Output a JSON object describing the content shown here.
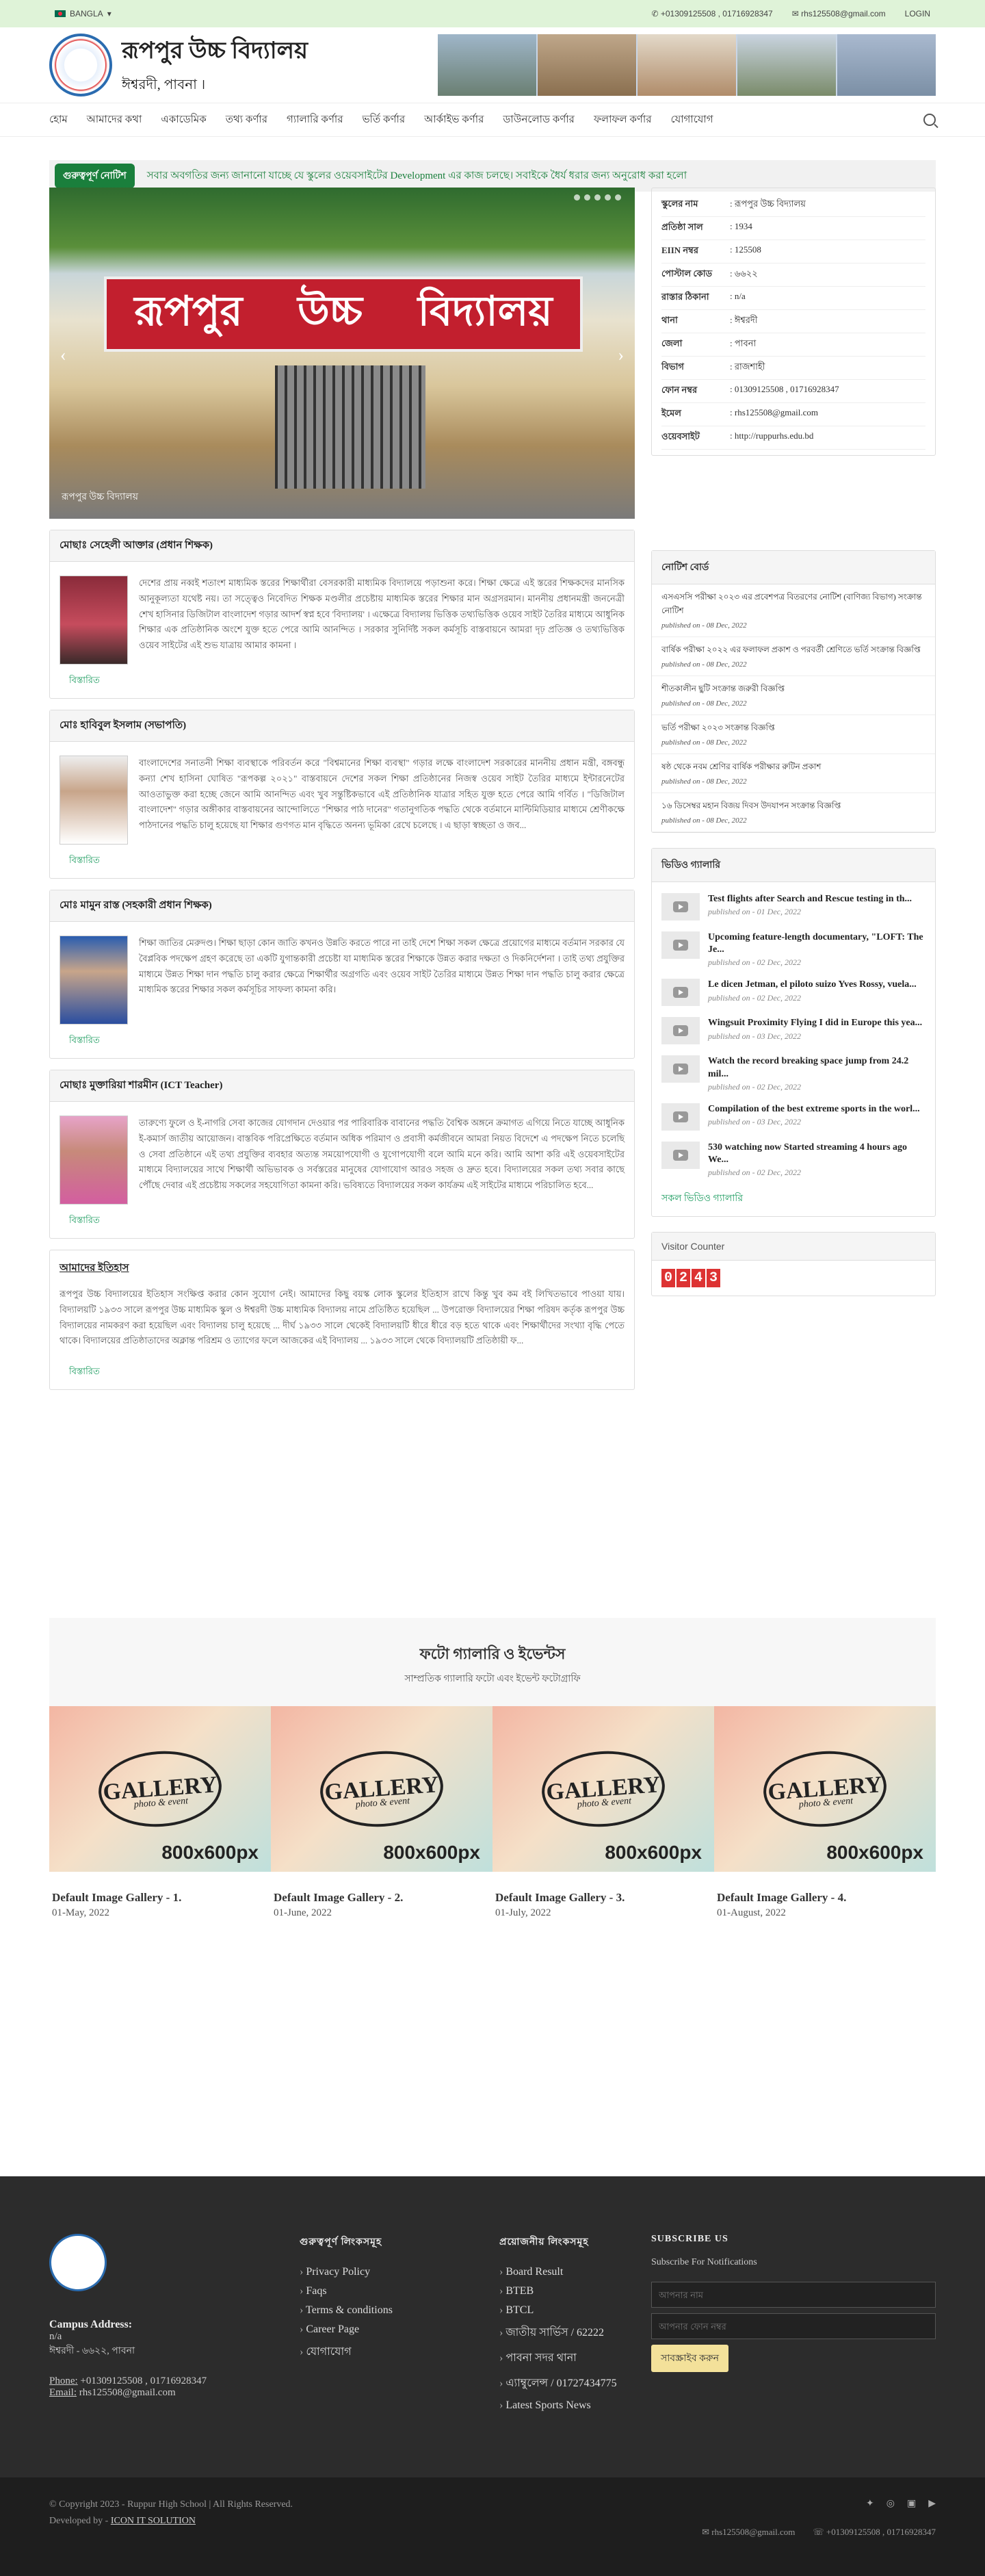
{
  "topbar": {
    "lang": "BANGLA",
    "phone": "+01309125508 , 01716928347",
    "email": "rhs125508@gmail.com",
    "login": "LOGIN"
  },
  "header": {
    "name": "রূপপুর উচ্চ বিদ্যালয়",
    "address": "ঈশ্বরদী, পাবনা ।"
  },
  "nav": [
    "হোম",
    "আমাদের কথা",
    "একাডেমিক",
    "তথ্য কর্ণার",
    "গ্যালারি কর্ণার",
    "ভর্তি কর্ণার",
    "আর্কাইভ কর্ণার",
    "ডাউনলোড কর্ণার",
    "ফলাফল কর্ণার",
    "যোগাযোগ"
  ],
  "notice": {
    "label": "গুরুত্বপূর্ণ নোটিশ",
    "text": "সবার অবগতির জন্য জানানো যাচ্ছে যে স্কুলের ওয়েবসাইটের Development এর কাজ চলছে। সবাইকে ধৈর্য ধরার জন্য অনুরোধ করা হলো"
  },
  "slider": {
    "sign": [
      "রূপপুর",
      "উচ্চ",
      "বিদ্যালয়"
    ],
    "caption": "রূপপুর উচ্চ বিদ্যালয়"
  },
  "messages": [
    {
      "title": "মোছাঃ সেহেলী আক্তার (প্রধান শিক্ষক)",
      "text": "দেশের প্রায় নব্বই শতাংশ মাধ্যমিক স্তরের শিক্ষার্থীরা বেসরকারী মাধ্যমিক বিদ্যালয়ে পড়াশুনা করে। শিক্ষা ক্ষেত্রে এই স্তরের শিক্ষকদের মানসিক আনুকূল্যতা যথেষ্ট নয়। তা সত্ত্বেও নিবেদিত শিক্ষক মণ্ডলীর প্রচেষ্টায় মাধ্যমিক স্তরের শিক্ষার মান অগ্রসরমান। মাননীয় প্রধানমন্ত্রী জননেত্রী শেখ হাসিনার ডিজিটাল বাংলাদেশ গড়ার আদর্শ স্বপ্ন হবে 'বিদ্যালয়' । এক্ষেত্রে বিদ্যালয় ভিত্তিক তথ্যভিত্তিক ওয়েব সাইট তৈরির মাধ্যমে আধুনিক শিক্ষার এক প্রতিষ্ঠানিক অংশে যুক্ত হতে পেরে আমি আনন্দিত । সরকার সুনির্দিষ্ট সকল কর্মসূচি বাস্তবায়নে আমরা দৃঢ় প্রতিজ্ঞ ও তথ্যভিত্তিক ওয়েব সাইটের এই শুভ যাত্রায় আমার কামনা ।",
      "more": "বিস্তারিত"
    },
    {
      "title": "মোঃ হাবিবুল ইসলাম (সভাপতি)",
      "text": "বাংলাদেশের সনাতনী শিক্ষা ব্যবস্থাকে পরিবর্তন করে \"বিশ্বমানের শিক্ষা ব্যবস্থা\" গড়ার লক্ষে বাংলাদেশ সরকারের মাননীয় প্রধান মন্ত্রী, বঙ্গবন্ধু কন্যা শেখ হাসিনা ঘোষিত \"রূপকল্প ২০২১\" বাস্তবায়নে দেশের সকল শিক্ষা প্রতিষ্ঠানের নিজস্ব ওয়েব সাইট তৈরির মাধ্যমে ইন্টারনেটের আওতাভুক্ত করা হচ্ছে জেনে আমি আনন্দিত এবং খুব সন্তুষ্টিকভাবে এই প্রতিষ্ঠানিক যাত্রার সহিত যুক্ত হতে পেরে আমি গর্বিত । \"ডিজিটাল বাংলাদেশ\" গড়ার অঙ্গীকার বাস্তবায়নের আন্দোলিতে \"শিক্ষার পাঠ দানের\" গতানুগতিক পদ্ধতি থেকে বর্তমানে মাল্টিমিডিয়ার মাধ্যমে শ্রেণীকক্ষে পাঠদানের পদ্ধতি চালু হয়েছে যা শিক্ষার গুণগত মান বৃদ্ধিতে অনন্য ভূমিকা রেখে চলেছে । এ ছাড়া স্বচ্ছতা ও জব...",
      "more": "বিস্তারিত"
    },
    {
      "title": "মোঃ মামুন রাস্ত (সহকারী প্রধান শিক্ষক)",
      "text": "শিক্ষা জাতির মেরুদণ্ড। শিক্ষা ছাড়া কোন জাতি কখনও উন্নতি করতে পারে না তাই দেশে শিক্ষা সকল ক্ষেত্রে প্রয়োগের মাধ্যমে বর্তমান সরকার যে বৈপ্লবিক পদক্ষেপ গ্রহণ করেছে তা একটি যুগান্তকারী প্রচেষ্টা যা মাধ্যমিক স্তরের শিক্ষাকে উন্নত করার দক্ষতা ও দিকনির্দেশনা । তাই তথ্য প্রযুক্তির মাধ্যমে উন্নত শিক্ষা দান পদ্ধতি চালু করার ক্ষেত্রে শিক্ষার্থীর অগ্রগতি এবং ওয়েব সাইট তৈরির মাধ্যমে উন্নত শিক্ষা দান পদ্ধতি চালু করার ক্ষেত্রে মাধ্যমিক স্তরের শিক্ষার সকল কর্মসূচির সাফল্য কামনা করি।",
      "more": "বিস্তারিত"
    },
    {
      "title": "মোছাঃ মুক্তারিয়া শারমীন (ICT Teacher)",
      "text": "তারুণ্যে ফুলে ও ই-নাগরি সেবা কাজের যোগদান দেওয়ার পর পারিবারিক বাবানের পদ্ধতি বৈশ্বিক অঙ্গনে ক্রমাগত এগিয়ে নিতে যাচ্ছে আধুনিক ই-কমার্স জাতীয় আয়োজন। বাস্তবিক পরিপ্রেক্ষিতে বর্তমান অধিক পরিমাণ ও প্রবাসী কর্মজীবনে আমরা নিয়ত বিদেশে এ পদক্ষেপ নিতে চলেছি ও সেবা প্রতিষ্ঠানে এই তথ্য প্রযুক্তির ব্যবহার অত্যন্ত সময়োপযোগী ও যুগোপযোগী বলে আমি মনে করি। আমি আশা করি এই ওয়েবসাইটের মাধ্যমে বিদ্যালয়ের সাথে শিক্ষার্থী অভিভাবক ও সর্বস্তরের মানুষের যোগাযোগ আরও সহজ ও দ্রুত হবে। বিদ্যালয়ের সকল তথ্য সবার কাছে পৌঁছে দেবার এই প্রচেষ্টায় সকলের সহযোগিতা কামনা করি। ভবিষ্যতে বিদ্যালয়ের সকল কার্যক্রম এই সাইটের মাধ্যমে পরিচালিত হবে...",
      "more": "বিস্তারিত"
    }
  ],
  "history": {
    "title": "আমাদের ইতিহাস",
    "text": "রূপপুর উচ্চ বিদ্যালয়ের ইতিহাস সংক্ষিপ্ত করার কোন সুযোগ নেই। আমাদের কিছু বয়স্ক লোক স্কুলের ইতিহাস রাখে কিন্তু খুব কম বই লিখিতভাবে পাওয়া যায়। বিদ্যালয়টি ১৯৩৩ সালে রূপপুর উচ্চ মাধ্যমিক স্কুল ও ঈশ্বরদী উচ্চ মাধ্যমিক বিদ্যালয় নামে প্রতিষ্ঠিত হয়েছিল ... উপরোক্ত বিদ্যালয়ের শিক্ষা পরিষদ কর্তৃক রূপপুর উচ্চ বিদ্যালয়ের নামকরণ করা হয়েছিল এবং বিদ্যালয় চালু হয়েছে ... দীর্ঘ ১৯৩৩ সালে থেকেই বিদ্যালয়টি ধীরে ধীরে বড় হতে থাকে এবং শিক্ষার্থীদের সংখ্যা বৃদ্ধি পেতে থাকে। বিদ্যালয়ের প্রতিষ্ঠাতাদের অক্লান্ত পরিশ্রম ও ত্যাগের ফলে আজকের এই বিদ্যালয় ... ১৯৩৩ সালে থেকে বিদ্যালয়টি প্রতিষ্ঠায়ী ফ...",
    "more": "বিস্তারিত"
  },
  "info": [
    [
      "স্কুলের নাম",
      ": রূপপুর উচ্চ বিদ্যালয়"
    ],
    [
      "প্রতিষ্ঠা সাল",
      ": 1934"
    ],
    [
      "EIIN নম্বর",
      ": 125508"
    ],
    [
      "পোস্টাল কোড",
      ": ৬৬২২"
    ],
    [
      "রাস্তার ঠিকানা",
      ": n/a"
    ],
    [
      "থানা",
      ": ঈশ্বরদী"
    ],
    [
      "জেলা",
      ": পাবনা"
    ],
    [
      "বিভাগ",
      ": রাজশাহী"
    ],
    [
      "ফোন নম্বর",
      ": 01309125508 , 01716928347"
    ],
    [
      "ইমেল",
      ": rhs125508@gmail.com"
    ],
    [
      "ওয়েবসাইট",
      ": http://ruppurhs.edu.bd"
    ]
  ],
  "notices": {
    "title": "নোটিশ বোর্ড",
    "items": [
      {
        "t": "এসএসসি পরীক্ষা ২০২৩ এর প্রবেশপত্র বিতরণের নোটিশ (বাণিজ্য বিভাগ) সংক্রান্ত নোটিশ",
        "d": "published on - 08 Dec, 2022"
      },
      {
        "t": "বার্ষিক পরীক্ষা ২০২২ এর ফলাফল প্রকাশ ও পরবর্তী শ্রেণিতে ভর্তি সংক্রান্ত বিজ্ঞপ্তি",
        "d": "published on - 08 Dec, 2022"
      },
      {
        "t": "শীতকালীন ছুটি সংক্রান্ত জরুরী বিজ্ঞপ্তি",
        "d": "published on - 08 Dec, 2022"
      },
      {
        "t": "ভর্তি পরীক্ষা ২০২৩ সংক্রান্ত বিজ্ঞপ্তি",
        "d": "published on - 08 Dec, 2022"
      },
      {
        "t": "ষষ্ঠ থেকে নবম শ্রেণির বার্ষিক পরীক্ষার রুটিন প্রকাশ",
        "d": "published on - 08 Dec, 2022"
      },
      {
        "t": "১৬ ডিসেম্বর মহান বিজয় দিবস উদযাপন সংক্রান্ত বিজ্ঞপ্তি",
        "d": "published on - 08 Dec, 2022"
      }
    ]
  },
  "videos": {
    "title": "ভিডিও গ্যালারি",
    "items": [
      {
        "t": "Test flights after Search and Rescue testing in th...",
        "d": "published on - 01 Dec, 2022"
      },
      {
        "t": "Upcoming feature-length documentary, \"LOFT: The Je...",
        "d": "published on - 02 Dec, 2022"
      },
      {
        "t": "Le dicen Jetman, el piloto suizo Yves Rossy, vuela...",
        "d": "published on - 02 Dec, 2022"
      },
      {
        "t": "Wingsuit Proximity Flying I did in Europe this yea...",
        "d": "published on - 03 Dec, 2022"
      },
      {
        "t": "Watch the record breaking space jump from 24.2 mil...",
        "d": "published on - 02 Dec, 2022"
      },
      {
        "t": "Compilation of the best extreme sports in the worl...",
        "d": "published on - 03 Dec, 2022"
      },
      {
        "t": "530 watching now Started streaming 4 hours ago We...",
        "d": "published on - 02 Dec, 2022"
      }
    ],
    "more": "সকল ভিডিও গ্যালারি"
  },
  "visitor": {
    "title": "Visitor Counter",
    "digits": [
      "0",
      "2",
      "4",
      "3"
    ]
  },
  "gallery": {
    "title": "ফটো গ্যালারি ও ইভেন্টস",
    "sub": "সাম্প্রতিক গ্যালারি ফটো এবং ইভেন্ট ফটোগ্রাফি",
    "img_text": "GALLERY",
    "img_top": "photo & event",
    "img_size": "800x600px",
    "items": [
      {
        "t": "Default Image Gallery - 1.",
        "d": "01-May, 2022"
      },
      {
        "t": "Default Image Gallery - 2.",
        "d": "01-June, 2022"
      },
      {
        "t": "Default Image Gallery - 3.",
        "d": "01-July, 2022"
      },
      {
        "t": "Default Image Gallery - 4.",
        "d": "01-August, 2022"
      }
    ]
  },
  "footer": {
    "campus_label": "Campus Address:",
    "campus1": "n/a",
    "campus2": "ঈশ্বরদী - ৬৬২২, পাবনা",
    "phone_label": "Phone:",
    "phone": "+01309125508 , 01716928347",
    "email_label": "Email:",
    "email": "rhs125508@gmail.com",
    "col1_title": "গুরুত্বপূর্ণ লিংকসমূহ",
    "col1": [
      "Privacy Policy",
      "Faqs",
      "Terms & conditions",
      "Career Page",
      "যোগাযোগ"
    ],
    "col2_title": "প্রয়োজনীয় লিংকসমূহ",
    "col2": [
      "Board Result",
      "BTEB",
      "BTCL",
      "জাতীয় সার্ভিস / 62222",
      "পাবনা সদর থানা",
      "এ্যাম্বুলেন্স / 01727434775",
      "Latest Sports News"
    ],
    "sub_title": "SUBSCRIBE US",
    "sub_text": "Subscribe For Notifications",
    "ph1": "আপনার নাম",
    "ph2": "আপনার ফোন নম্বর",
    "btn": "সাবস্ক্রাইব করুন",
    "copyright": "© Copyright 2023 - Ruppur High School | All Rights Reserved.",
    "dev_label": "Developed by - ",
    "dev": "ICON IT SOLUTION",
    "b_email": "rhs125508@gmail.com",
    "b_phone": "+01309125508 , 01716928347"
  }
}
